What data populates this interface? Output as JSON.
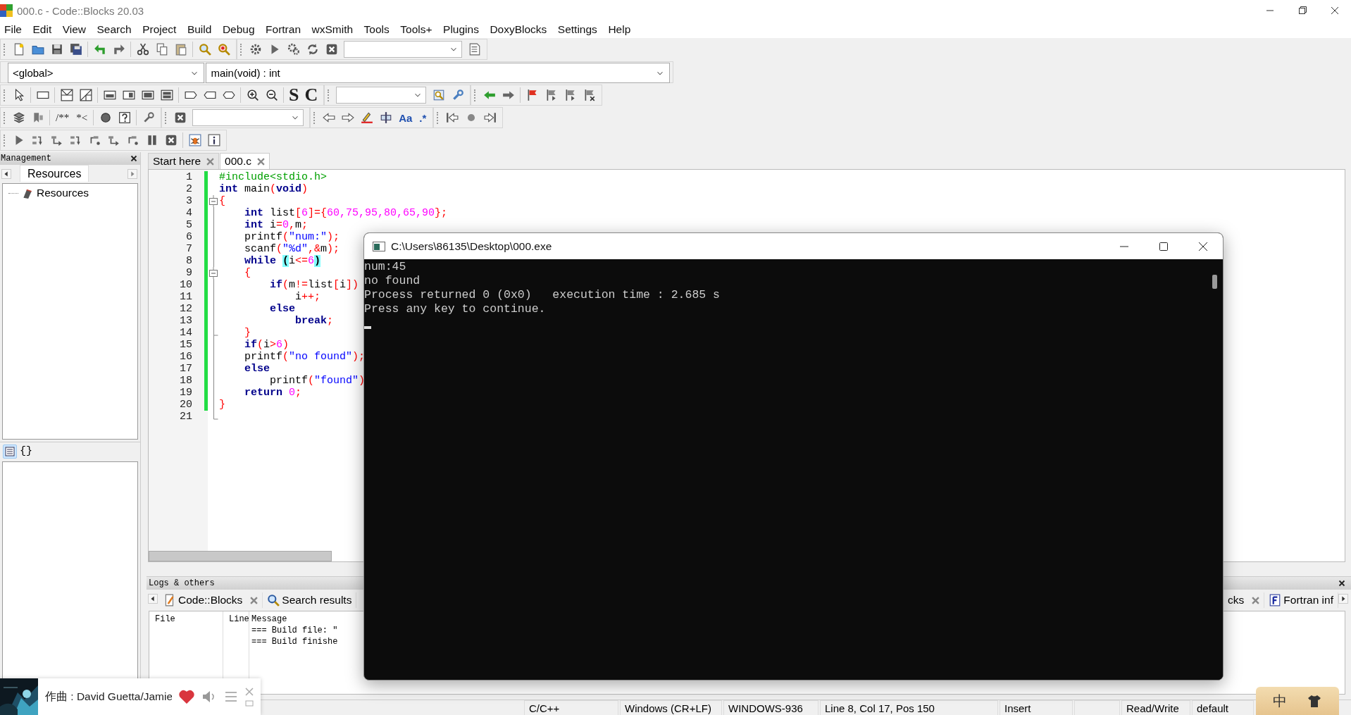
{
  "window": {
    "title": "000.c - Code::Blocks 20.03"
  },
  "menu": [
    "File",
    "Edit",
    "View",
    "Search",
    "Project",
    "Build",
    "Debug",
    "Fortran",
    "wxSmith",
    "Tools",
    "Tools+",
    "Plugins",
    "DoxyBlocks",
    "Settings",
    "Help"
  ],
  "toolbars": {
    "scope": "<global>",
    "function": "main(void) : int",
    "text_icons": [
      "S",
      "C",
      "/**",
      "*<",
      "Aa",
      ".*"
    ]
  },
  "management": {
    "title": "Management",
    "tab": "Resources",
    "tree": [
      {
        "label": "Resources"
      }
    ],
    "symbols_tab": "{}"
  },
  "editor": {
    "tabs": [
      {
        "label": "Start here",
        "selected": false
      },
      {
        "label": "000.c",
        "selected": true
      }
    ],
    "lines": [
      {
        "number": "1",
        "changed": true,
        "tokens": [
          {
            "text": "#include<stdio.h>",
            "kind": "pre"
          }
        ]
      },
      {
        "number": "2",
        "changed": true,
        "tokens": [
          {
            "text": "int",
            "kind": "kw"
          },
          {
            "text": " main",
            "kind": "plain"
          },
          {
            "text": "(",
            "kind": "op"
          },
          {
            "text": "void",
            "kind": "kw"
          },
          {
            "text": ")",
            "kind": "op"
          }
        ]
      },
      {
        "number": "3",
        "changed": true,
        "fold_box": true,
        "tokens": [
          {
            "text": "{",
            "kind": "op"
          }
        ]
      },
      {
        "number": "4",
        "changed": true,
        "tokens": [
          {
            "text": "    int",
            "kind": "kw"
          },
          {
            "text": " list",
            "kind": "plain"
          },
          {
            "text": "[",
            "kind": "op"
          },
          {
            "text": "6",
            "kind": "num"
          },
          {
            "text": "]={",
            "kind": "op"
          },
          {
            "text": "60,75,95,80,65,90",
            "kind": "num"
          },
          {
            "text": "};",
            "kind": "op"
          }
        ]
      },
      {
        "number": "5",
        "changed": true,
        "tokens": [
          {
            "text": "    int",
            "kind": "kw"
          },
          {
            "text": " i",
            "kind": "plain"
          },
          {
            "text": "=",
            "kind": "op"
          },
          {
            "text": "0",
            "kind": "num"
          },
          {
            "text": ",",
            "kind": "op"
          },
          {
            "text": "m",
            "kind": "plain"
          },
          {
            "text": ";",
            "kind": "op"
          }
        ]
      },
      {
        "number": "6",
        "changed": true,
        "tokens": [
          {
            "text": "    printf",
            "kind": "plain"
          },
          {
            "text": "(",
            "kind": "op"
          },
          {
            "text": "\"num:\"",
            "kind": "str"
          },
          {
            "text": ");",
            "kind": "op"
          }
        ]
      },
      {
        "number": "7",
        "changed": true,
        "tokens": [
          {
            "text": "    scanf",
            "kind": "plain"
          },
          {
            "text": "(",
            "kind": "op"
          },
          {
            "text": "\"%d\"",
            "kind": "str"
          },
          {
            "text": ",&",
            "kind": "op"
          },
          {
            "text": "m",
            "kind": "plain"
          },
          {
            "text": ");",
            "kind": "op"
          }
        ]
      },
      {
        "number": "8",
        "changed": true,
        "tokens": [
          {
            "text": "    while ",
            "kind": "kw"
          },
          {
            "text": "(",
            "kind": "match"
          },
          {
            "text": "i",
            "kind": "plain"
          },
          {
            "text": "<=",
            "kind": "op"
          },
          {
            "text": "6",
            "kind": "num"
          },
          {
            "text": ")",
            "kind": "match"
          }
        ]
      },
      {
        "number": "9",
        "changed": true,
        "fold_box": true,
        "tokens": [
          {
            "text": "    {",
            "kind": "op"
          }
        ]
      },
      {
        "number": "10",
        "changed": true,
        "tokens": [
          {
            "text": "        if",
            "kind": "kw"
          },
          {
            "text": "(",
            "kind": "op"
          },
          {
            "text": "m",
            "kind": "plain"
          },
          {
            "text": "!=",
            "kind": "op"
          },
          {
            "text": "list",
            "kind": "plain"
          },
          {
            "text": "[",
            "kind": "op"
          },
          {
            "text": "i",
            "kind": "plain"
          },
          {
            "text": "])",
            "kind": "op"
          }
        ]
      },
      {
        "number": "11",
        "changed": true,
        "tokens": [
          {
            "text": "            i",
            "kind": "plain"
          },
          {
            "text": "++;",
            "kind": "op"
          }
        ]
      },
      {
        "number": "12",
        "changed": true,
        "tokens": [
          {
            "text": "        else",
            "kind": "kw"
          }
        ]
      },
      {
        "number": "13",
        "changed": true,
        "tokens": [
          {
            "text": "            break",
            "kind": "kw"
          },
          {
            "text": ";",
            "kind": "op"
          }
        ]
      },
      {
        "number": "14",
        "changed": true,
        "fold_end": true,
        "tokens": [
          {
            "text": "    }",
            "kind": "op"
          }
        ]
      },
      {
        "number": "15",
        "changed": true,
        "tokens": [
          {
            "text": "    if",
            "kind": "kw"
          },
          {
            "text": "(",
            "kind": "op"
          },
          {
            "text": "i",
            "kind": "plain"
          },
          {
            "text": ">",
            "kind": "op"
          },
          {
            "text": "6",
            "kind": "num"
          },
          {
            "text": ")",
            "kind": "op"
          }
        ]
      },
      {
        "number": "16",
        "changed": true,
        "tokens": [
          {
            "text": "    printf",
            "kind": "plain"
          },
          {
            "text": "(",
            "kind": "op"
          },
          {
            "text": "\"no found\"",
            "kind": "str"
          },
          {
            "text": ");",
            "kind": "op"
          }
        ]
      },
      {
        "number": "17",
        "changed": true,
        "tokens": [
          {
            "text": "    else",
            "kind": "kw"
          }
        ]
      },
      {
        "number": "18",
        "changed": true,
        "tokens": [
          {
            "text": "        printf",
            "kind": "plain"
          },
          {
            "text": "(",
            "kind": "op"
          },
          {
            "text": "\"found\"",
            "kind": "str"
          },
          {
            "text": ")",
            "kind": "op"
          }
        ]
      },
      {
        "number": "19",
        "changed": true,
        "tokens": [
          {
            "text": "    return ",
            "kind": "kw"
          },
          {
            "text": "0",
            "kind": "num"
          },
          {
            "text": ";",
            "kind": "op"
          }
        ]
      },
      {
        "number": "20",
        "changed": true,
        "tokens": [
          {
            "text": "}",
            "kind": "op"
          }
        ]
      },
      {
        "number": "21",
        "changed": false,
        "fold_end": true
      }
    ]
  },
  "logs": {
    "title": "Logs & others",
    "tabs": [
      {
        "label": "Code::Blocks",
        "closable": true
      },
      {
        "label": "Search results",
        "closable": false
      },
      {
        "label": "cks",
        "closable": true
      },
      {
        "label": "Fortran inf",
        "closable": false
      }
    ],
    "columns": [
      "File",
      "Line",
      "Message"
    ],
    "messages": [
      "=== Build file: \"",
      "=== Build finishe"
    ]
  },
  "console": {
    "title": "C:\\Users\\86135\\Desktop\\000.exe",
    "lines": [
      "num:45",
      "no found",
      "Process returned 0 (0x0)   execution time : 2.685 s",
      "Press any key to continue."
    ]
  },
  "status_bar": [
    "C/C++",
    "Windows (CR+LF)",
    "WINDOWS-936",
    "Line 8, Col 17, Pos 150",
    "Insert",
    "Read/Write",
    "default"
  ],
  "music": {
    "text": "作曲 : David Guetta/Jamie",
    "liked": true
  },
  "ime": {
    "mode": "中"
  }
}
